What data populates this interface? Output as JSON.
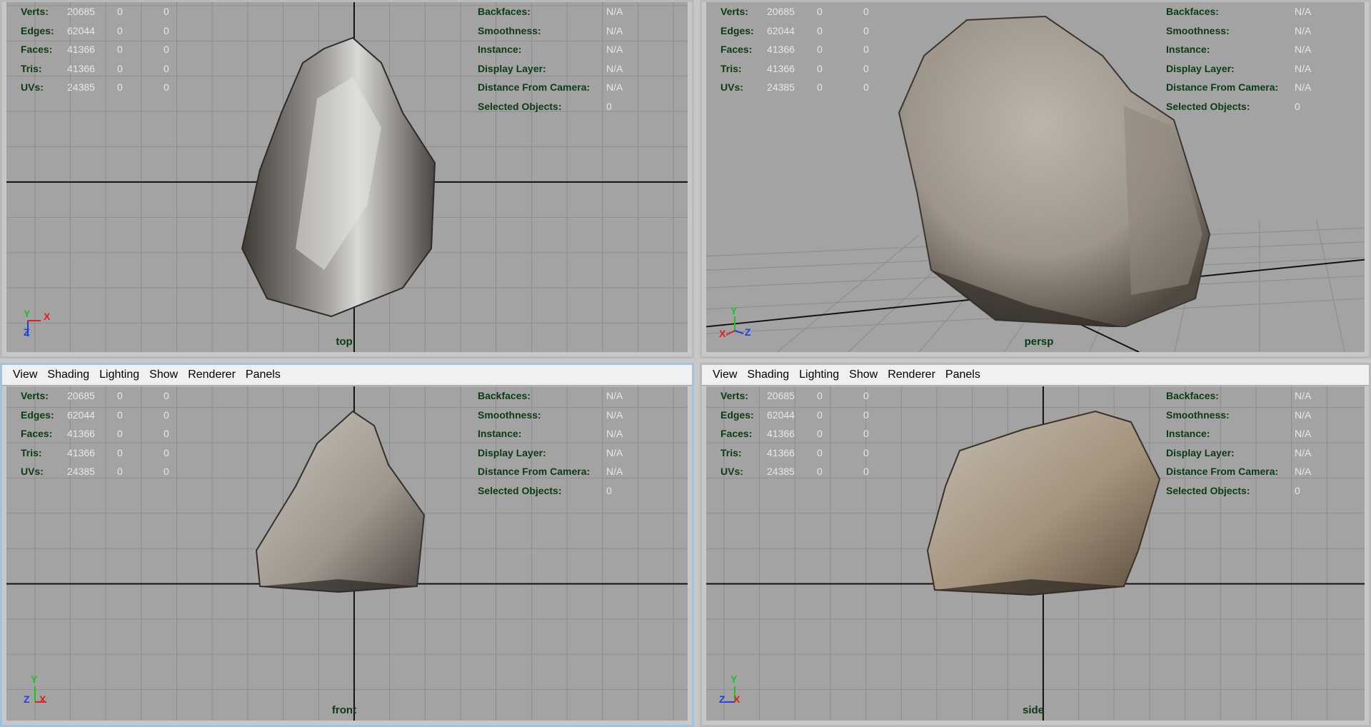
{
  "menu": [
    "View",
    "Shading",
    "Lighting",
    "Show",
    "Renderer",
    "Panels"
  ],
  "hud": {
    "left": [
      {
        "label": "Verts:",
        "a": "20685",
        "b": "0",
        "c": "0"
      },
      {
        "label": "Edges:",
        "a": "62044",
        "b": "0",
        "c": "0"
      },
      {
        "label": "Faces:",
        "a": "41366",
        "b": "0",
        "c": "0"
      },
      {
        "label": "Tris:",
        "a": "41366",
        "b": "0",
        "c": "0"
      },
      {
        "label": "UVs:",
        "a": "24385",
        "b": "0",
        "c": "0"
      }
    ],
    "right": [
      {
        "label": "Backfaces:",
        "value": "N/A"
      },
      {
        "label": "Smoothness:",
        "value": "N/A"
      },
      {
        "label": "Instance:",
        "value": "N/A"
      },
      {
        "label": "Display Layer:",
        "value": "N/A"
      },
      {
        "label": "Distance From Camera:",
        "value": "N/A"
      },
      {
        "label": "Selected Objects:",
        "value": "0"
      }
    ]
  },
  "views": {
    "top": {
      "camera": "top"
    },
    "persp": {
      "camera": "persp"
    },
    "front": {
      "camera": "front"
    },
    "side": {
      "camera": "side"
    }
  },
  "axes": {
    "top": [
      "Y",
      "X",
      "Z"
    ],
    "persp": [
      "Y",
      "X",
      "Z"
    ],
    "front": [
      "Y",
      "Z",
      "X"
    ],
    "side": [
      "Y",
      "Z",
      "X"
    ]
  },
  "colors": {
    "viewport_bg": "#a3a3a3",
    "grid": "#8d8d8d",
    "hud_label": "#0b3b13",
    "hud_value": "#e8e8e8",
    "axis_x": "#e02020",
    "axis_y": "#20c020",
    "axis_z": "#2040e0"
  }
}
